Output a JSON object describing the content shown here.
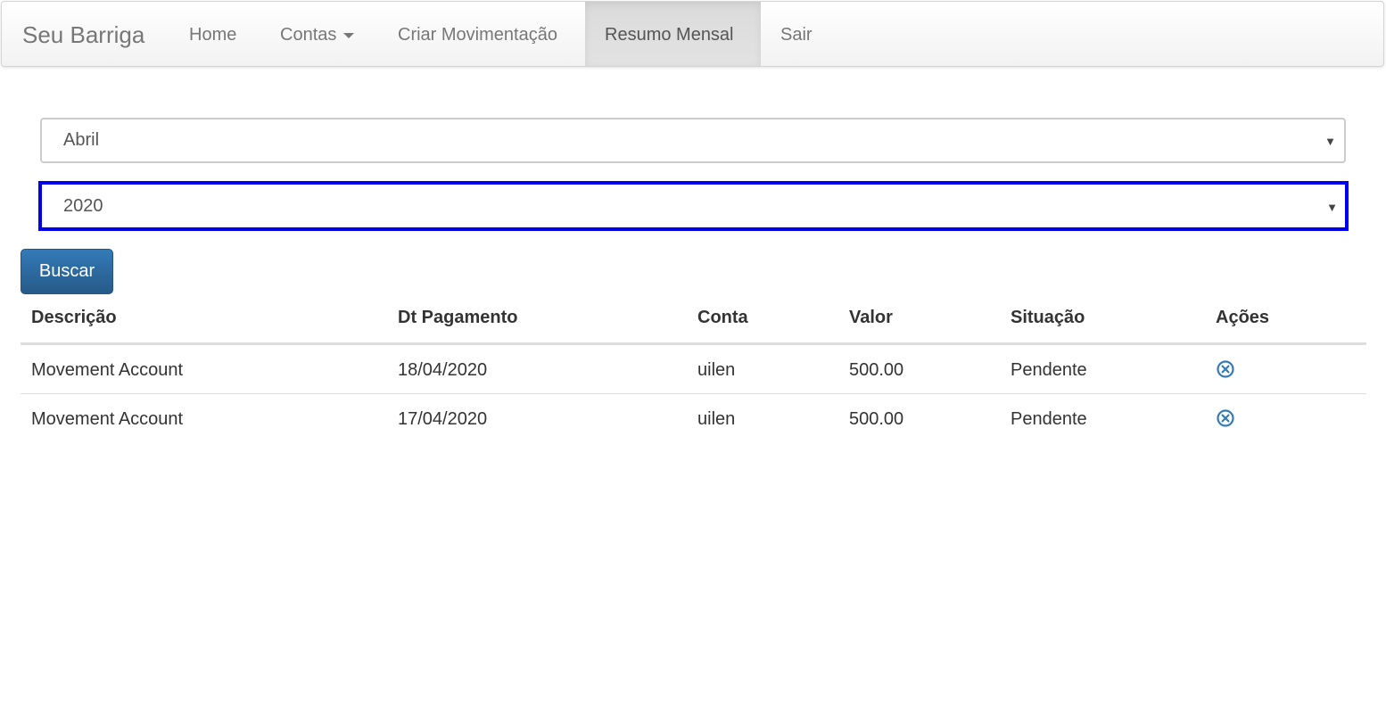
{
  "navbar": {
    "brand": "Seu Barriga",
    "items": [
      {
        "label": "Home"
      },
      {
        "label": "Contas"
      },
      {
        "label": "Criar Movimentação"
      },
      {
        "label": "Resumo Mensal"
      },
      {
        "label": "Sair"
      }
    ],
    "active_item": "Resumo Mensal"
  },
  "form": {
    "month_selected": "Abril",
    "year_selected": "2020",
    "search_button": "Buscar"
  },
  "table": {
    "headers": [
      "Descrição",
      "Dt Pagamento",
      "Conta",
      "Valor",
      "Situação",
      "Ações"
    ],
    "rows": [
      {
        "descricao": "Movement Account",
        "dt_pagamento": "18/04/2020",
        "conta": "uilen",
        "valor": "500.00",
        "situacao": "Pendente",
        "acao_icon": "remove-circle-icon"
      },
      {
        "descricao": "Movement Account",
        "dt_pagamento": "17/04/2020",
        "conta": "uilen",
        "valor": "500.00",
        "situacao": "Pendente",
        "acao_icon": "remove-circle-icon"
      }
    ]
  },
  "colors": {
    "primary_button": "#337ab7",
    "focus_outline": "#0000ee",
    "action_icon": "#337ab7"
  }
}
